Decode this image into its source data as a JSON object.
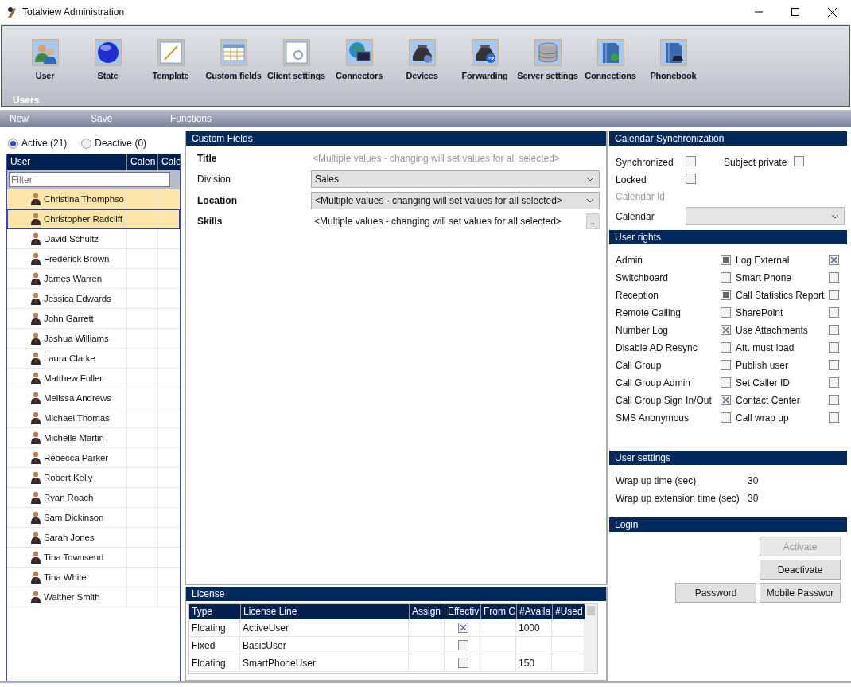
{
  "window": {
    "title": "Totalview  Administration"
  },
  "ribbon": {
    "items": [
      {
        "label": "User"
      },
      {
        "label": "State"
      },
      {
        "label": "Template"
      },
      {
        "label": "Custom fields"
      },
      {
        "label": "Client settings"
      },
      {
        "label": "Connectors"
      },
      {
        "label": "Devices"
      },
      {
        "label": "Forwarding"
      },
      {
        "label": "Server settings"
      },
      {
        "label": "Connections"
      },
      {
        "label": "Phonebook"
      }
    ],
    "section": "Users"
  },
  "commands": [
    "New",
    "Save",
    "Functions"
  ],
  "user_filter": {
    "options": [
      {
        "label": "Active (21)",
        "selected": true
      },
      {
        "label": "Deactive (0)",
        "selected": false
      }
    ],
    "columns": [
      "User",
      "Calen",
      "Cale"
    ],
    "filter": {
      "placeholder": "Filter"
    },
    "users": [
      {
        "name": "Christina Thomphso",
        "selected": true,
        "focused": false
      },
      {
        "name": "Christopher Radcliff",
        "selected": true,
        "focused": true
      },
      {
        "name": "David Schultz",
        "selected": false,
        "focused": false
      },
      {
        "name": "Frederick Brown",
        "selected": false,
        "focused": false
      },
      {
        "name": "James Warren",
        "selected": false,
        "focused": false
      },
      {
        "name": "Jessica Edwards",
        "selected": false,
        "focused": false
      },
      {
        "name": "John Garrett",
        "selected": false,
        "focused": false
      },
      {
        "name": "Joshua Williams",
        "selected": false,
        "focused": false
      },
      {
        "name": "Laura Clarke",
        "selected": false,
        "focused": false
      },
      {
        "name": "Matthew Fuller",
        "selected": false,
        "focused": false
      },
      {
        "name": "Melissa Andrews",
        "selected": false,
        "focused": false
      },
      {
        "name": "Michael Thomas",
        "selected": false,
        "focused": false
      },
      {
        "name": "Michelle Martin",
        "selected": false,
        "focused": false
      },
      {
        "name": "Rebecca Parker",
        "selected": false,
        "focused": false
      },
      {
        "name": "Robert Kelly",
        "selected": false,
        "focused": false
      },
      {
        "name": "Ryan Roach",
        "selected": false,
        "focused": false
      },
      {
        "name": "Sam Dickinson",
        "selected": false,
        "focused": false
      },
      {
        "name": "Sarah Jones",
        "selected": false,
        "focused": false
      },
      {
        "name": "Tina Townsend",
        "selected": false,
        "focused": false
      },
      {
        "name": "Tina White",
        "selected": false,
        "focused": false
      },
      {
        "name": "Walther Smith",
        "selected": false,
        "focused": false
      }
    ]
  },
  "custom_fields": {
    "title": "Custom Fields",
    "fields": [
      {
        "label": "Title",
        "emphasized": true,
        "kind": "text",
        "placeholder": "<Multiple values - changing will set values for all selected>"
      },
      {
        "label": "Division",
        "emphasized": false,
        "kind": "dropdown",
        "value": "Sales"
      },
      {
        "label": "Location",
        "emphasized": true,
        "kind": "dropdown",
        "value": "<Multiple values - changing will set values for all selected>"
      },
      {
        "label": "Skills",
        "emphasized": true,
        "kind": "picker",
        "value": "<Multiple values - changing will set values for all selected>",
        "button": ".."
      }
    ]
  },
  "license": {
    "title": "License",
    "columns": [
      "Type",
      "License Line",
      "Assign",
      "Effectiv",
      "From G",
      "#Availa",
      "#Used"
    ],
    "rows": [
      {
        "type": "Floating",
        "line": "ActiveUser",
        "effective": true,
        "available": "1000"
      },
      {
        "type": "Fixed",
        "line": "BasicUser",
        "effective": false
      },
      {
        "type": "Floating",
        "line": "SmartPhoneUser",
        "effective": false,
        "available": "150"
      }
    ]
  },
  "calendar_sync": {
    "title": "Calendar Synchronization",
    "synchronized": {
      "label": "Synchronized",
      "checked": false
    },
    "subject_private": {
      "label": "Subject private",
      "checked": false
    },
    "locked": {
      "label": "Locked",
      "checked": false
    },
    "calendar_id": {
      "label": "Calendar Id",
      "disabled": true
    },
    "calendar": {
      "label": "Calendar"
    }
  },
  "user_rights": {
    "title": "User rights",
    "items": [
      {
        "label": "Admin",
        "checked": false,
        "mixed": true
      },
      {
        "label": "Log External",
        "checked": true,
        "mixed": false
      },
      {
        "label": "Switchboard",
        "checked": false,
        "mixed": false
      },
      {
        "label": "Smart Phone",
        "checked": false,
        "mixed": false
      },
      {
        "label": "Reception",
        "checked": false,
        "mixed": true
      },
      {
        "label": "Call Statistics Report",
        "checked": false,
        "mixed": false
      },
      {
        "label": "Remote Calling",
        "checked": false,
        "mixed": false
      },
      {
        "label": "SharePoint",
        "checked": false,
        "mixed": false
      },
      {
        "label": "Number Log",
        "checked": true,
        "mixed": false
      },
      {
        "label": "Use Attachments",
        "checked": false,
        "mixed": false
      },
      {
        "label": "Disable AD Resync",
        "checked": false,
        "mixed": false
      },
      {
        "label": "Att. must load",
        "checked": false,
        "mixed": false
      },
      {
        "label": "Call Group",
        "checked": false,
        "mixed": false
      },
      {
        "label": "Publish user",
        "checked": false,
        "mixed": false
      },
      {
        "label": "Call Group Admin",
        "checked": false,
        "mixed": false
      },
      {
        "label": "Set Caller ID",
        "checked": false,
        "mixed": false
      },
      {
        "label": "Call Group Sign In/Out",
        "checked": true,
        "mixed": false
      },
      {
        "label": "Contact Center",
        "checked": false,
        "mixed": false
      },
      {
        "label": "SMS Anonymous",
        "checked": false,
        "mixed": false
      },
      {
        "label": "Call wrap up",
        "checked": false,
        "mixed": false
      }
    ]
  },
  "user_settings": {
    "title": "User settings",
    "rows": [
      {
        "label": "Wrap up time (sec)",
        "value": "30"
      },
      {
        "label": "Wrap up extension time (sec)",
        "value": "30"
      }
    ]
  },
  "login": {
    "title": "Login",
    "buttons": [
      {
        "label": "Activate",
        "disabled": true
      },
      {
        "label": "Deactivate",
        "disabled": false
      },
      {
        "label": "Password",
        "disabled": false
      },
      {
        "label": "Mobile Passwor",
        "disabled": false
      }
    ]
  }
}
